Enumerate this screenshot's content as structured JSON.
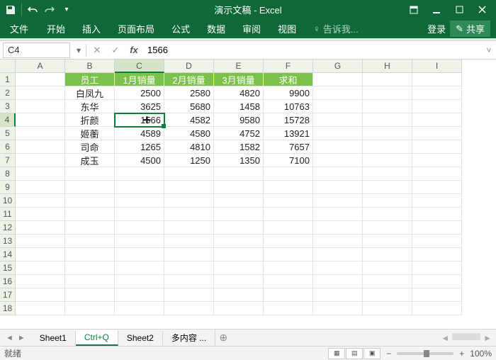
{
  "app": {
    "title": "演示文稿 - Excel"
  },
  "ribbon": {
    "tabs": {
      "file": "文件",
      "home": "开始",
      "insert": "插入",
      "pagelayout": "页面布局",
      "formulas": "公式",
      "data": "数据",
      "review": "审阅",
      "view": "视图"
    },
    "tellme": "告诉我...",
    "signin": "登录",
    "share": "共享"
  },
  "formula": {
    "nameBox": "C4",
    "value": "1566"
  },
  "columns": [
    "A",
    "B",
    "C",
    "D",
    "E",
    "F",
    "G",
    "H",
    "I"
  ],
  "headers": {
    "emp": "员工",
    "jan": "1月销量",
    "feb": "2月销量",
    "mar": "3月销量",
    "sum": "求和"
  },
  "chart_data": {
    "type": "table",
    "columns": [
      "员工",
      "1月销量",
      "2月销量",
      "3月销量",
      "求和"
    ],
    "rows": [
      {
        "emp": "白凤九",
        "jan": 2500,
        "feb": 2580,
        "mar": 4820,
        "sum": 9900
      },
      {
        "emp": "东华",
        "jan": 3625,
        "feb": 5680,
        "mar": 1458,
        "sum": 10763
      },
      {
        "emp": "折颜",
        "jan": 1566,
        "feb": 4582,
        "mar": 9580,
        "sum": 15728
      },
      {
        "emp": "姬蘅",
        "jan": 4589,
        "feb": 4580,
        "mar": 4752,
        "sum": 13921
      },
      {
        "emp": "司命",
        "jan": 1265,
        "feb": 4810,
        "mar": 1582,
        "sum": 7657
      },
      {
        "emp": "成玉",
        "jan": 4500,
        "feb": 1250,
        "mar": 1350,
        "sum": 7100
      }
    ]
  },
  "activeCell": "C4",
  "cellDisplay": "1566",
  "sheetTabs": {
    "s1": "Sheet1",
    "s2": "Ctrl+Q",
    "s3": "Sheet2",
    "s4": "多内容 ..."
  },
  "status": {
    "ready": "就绪",
    "zoom": "100%"
  }
}
